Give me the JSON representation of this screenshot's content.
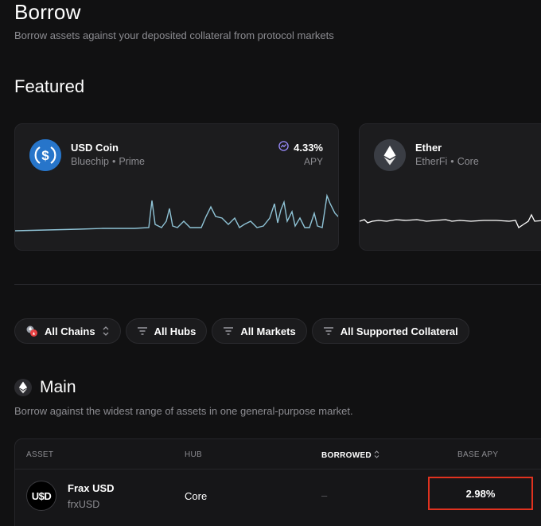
{
  "header": {
    "title": "Borrow",
    "subtitle": "Borrow assets against your deposited collateral from protocol markets"
  },
  "featured": {
    "title": "Featured",
    "cards": [
      {
        "name": "USD Coin",
        "tag1": "Bluechip",
        "tag2": "Prime",
        "apy": "4.33%",
        "apy_label": "APY",
        "icon": "usdc-icon",
        "spark_color": "#8fc3d6"
      },
      {
        "name": "Ether",
        "tag1": "EtherFi",
        "tag2": "Core",
        "icon": "ether-icon",
        "spark_color": "#ffffff"
      }
    ],
    "separator": "•"
  },
  "filters": [
    {
      "label": "All Chains",
      "icon": "chains-icon"
    },
    {
      "label": "All Hubs",
      "icon": "filter-icon"
    },
    {
      "label": "All Markets",
      "icon": "filter-icon"
    },
    {
      "label": "All Supported Collateral",
      "icon": "filter-icon"
    }
  ],
  "main": {
    "title": "Main",
    "subtitle": "Borrow against the widest range of assets in one general-purpose market.",
    "columns": {
      "asset": "ASSET",
      "hub": "HUB",
      "borrowed": "BORROWED",
      "base_apy": "BASE APY"
    },
    "rows": [
      {
        "name": "Frax USD",
        "symbol": "frxUSD",
        "hub": "Core",
        "borrowed": "–",
        "base_apy": "2.98%",
        "icon_text": "U$D"
      }
    ]
  },
  "colors": {
    "accent_usdc": "#2775ca",
    "highlight": "#e0321f",
    "background": "#111112"
  }
}
